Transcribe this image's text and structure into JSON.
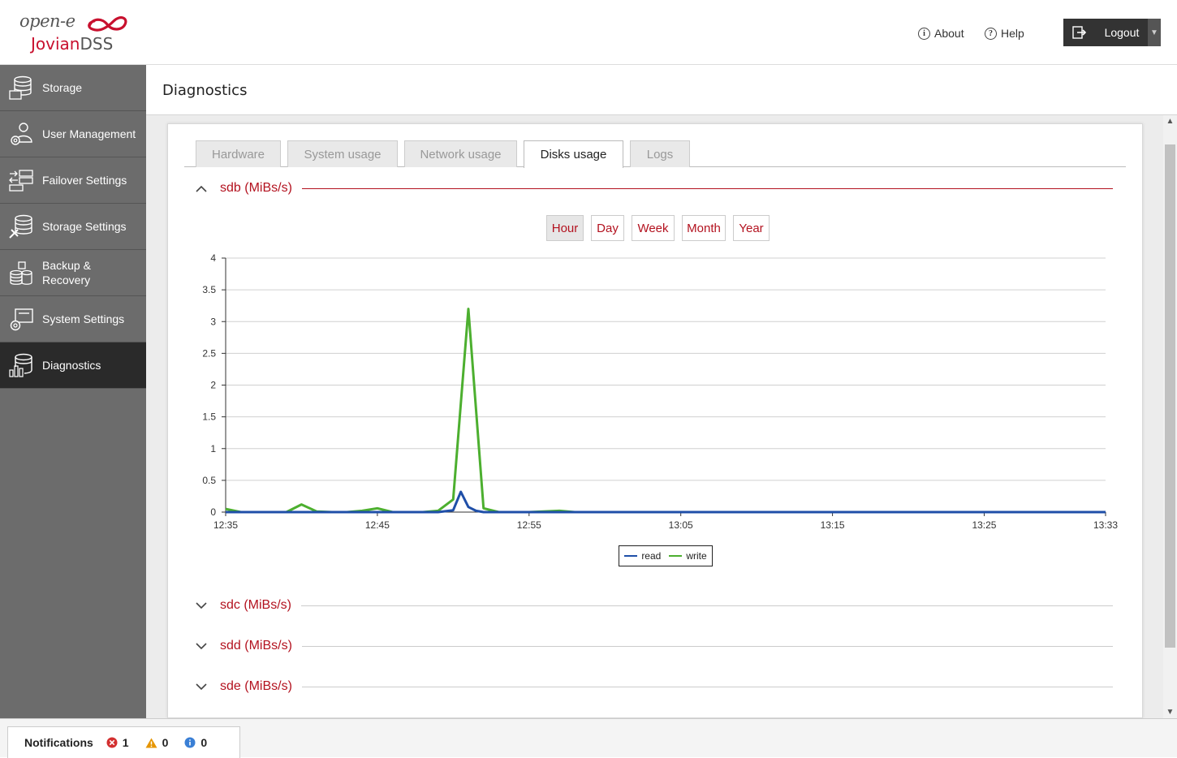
{
  "app": {
    "logo_top": "open-e",
    "logo_brand_red": "Jovian",
    "logo_brand_grey": "DSS"
  },
  "header": {
    "about_label": "About",
    "help_label": "Help",
    "logout_label": "Logout"
  },
  "sidebar": {
    "items": [
      {
        "label": "Storage",
        "icon": "database-icon"
      },
      {
        "label": "User Management",
        "icon": "user-gear-icon"
      },
      {
        "label": "Failover Settings",
        "icon": "failover-icon"
      },
      {
        "label": "Storage Settings",
        "icon": "storage-tools-icon"
      },
      {
        "label": "Backup & Recovery",
        "icon": "backup-icon"
      },
      {
        "label": "System Settings",
        "icon": "system-gear-icon"
      },
      {
        "label": "Diagnostics",
        "icon": "diagnostics-icon",
        "active": true
      }
    ]
  },
  "page": {
    "title": "Diagnostics"
  },
  "tabs": [
    {
      "label": "Hardware",
      "active": false
    },
    {
      "label": "System usage",
      "active": false
    },
    {
      "label": "Network usage",
      "active": false
    },
    {
      "label": "Disks usage",
      "active": true
    },
    {
      "label": "Logs",
      "active": false
    }
  ],
  "sections": [
    {
      "title": "sdb (MiBs/s)",
      "expanded": true
    },
    {
      "title": "sdc (MiBs/s)",
      "expanded": false
    },
    {
      "title": "sdd (MiBs/s)",
      "expanded": false
    },
    {
      "title": "sde (MiBs/s)",
      "expanded": false
    }
  ],
  "ranges": [
    {
      "label": "Hour",
      "active": true
    },
    {
      "label": "Day",
      "active": false
    },
    {
      "label": "Week",
      "active": false
    },
    {
      "label": "Month",
      "active": false
    },
    {
      "label": "Year",
      "active": false
    }
  ],
  "colors": {
    "accent": "#b3121f",
    "read": "#1f4fa8",
    "write": "#4caf2f"
  },
  "chart_data": {
    "type": "line",
    "title": "",
    "xlabel": "",
    "ylabel": "",
    "x_ticks": [
      "12:35",
      "12:45",
      "12:55",
      "13:05",
      "13:15",
      "13:25",
      "13:33"
    ],
    "x_tick_minutes": [
      0,
      10,
      20,
      30,
      40,
      50,
      58
    ],
    "y_ticks": [
      "0",
      "0.5",
      "1",
      "1.5",
      "2",
      "2.5",
      "3",
      "3.5",
      "4"
    ],
    "ylim": [
      0,
      4
    ],
    "xlim_minutes": [
      0,
      58
    ],
    "grid": true,
    "legend_position": "bottom-center",
    "series": [
      {
        "name": "read",
        "color": "#1f4fa8",
        "x_minutes": [
          0,
          1,
          4,
          5,
          6,
          7,
          8,
          9,
          10,
          11,
          12,
          13,
          14,
          15,
          15.5,
          16,
          16.5,
          17,
          18,
          19,
          20,
          25,
          30,
          40,
          50,
          58
        ],
        "values": [
          0,
          0,
          0,
          0,
          0,
          0,
          0,
          0,
          0,
          0,
          0,
          0,
          0,
          0.03,
          0.32,
          0.08,
          0.02,
          0,
          0,
          0,
          0,
          0,
          0,
          0,
          0,
          0
        ]
      },
      {
        "name": "write",
        "color": "#4caf2f",
        "x_minutes": [
          0,
          1,
          4,
          5,
          6,
          7,
          8,
          9,
          10,
          11,
          12,
          13,
          14,
          15,
          16,
          17,
          18,
          19,
          20,
          22,
          23,
          25,
          30,
          40,
          50,
          58
        ],
        "values": [
          0.05,
          0,
          0,
          0.12,
          0.01,
          0,
          0,
          0.02,
          0.06,
          0,
          0,
          0,
          0.02,
          0.2,
          3.2,
          0.06,
          0,
          0,
          0,
          0.02,
          0,
          0,
          0,
          0,
          0,
          0
        ]
      }
    ]
  },
  "notifications": {
    "label": "Notifications",
    "errors": "1",
    "warnings": "0",
    "info": "0"
  }
}
